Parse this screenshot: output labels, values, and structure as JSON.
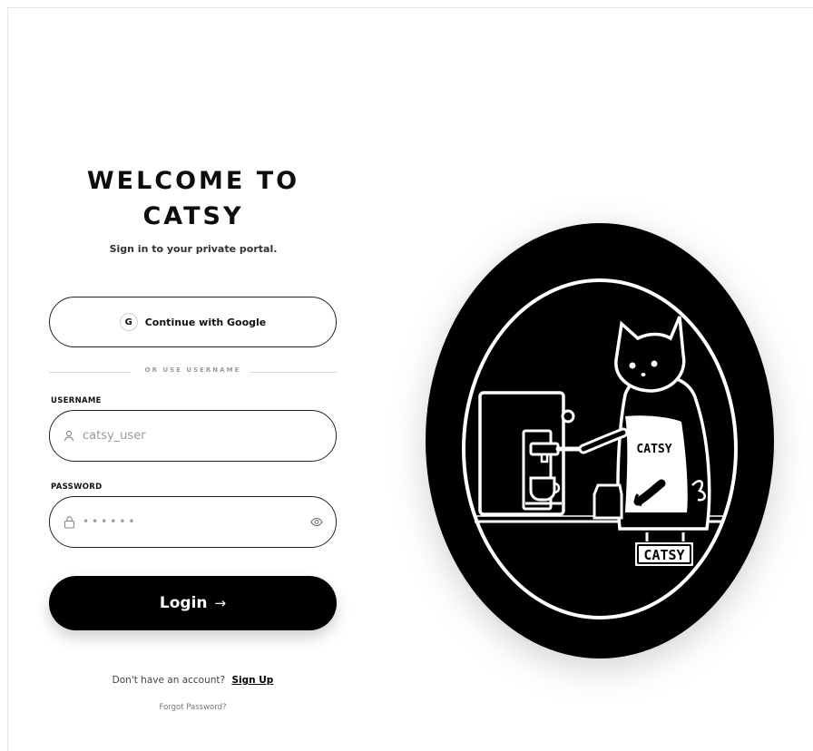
{
  "welcome": {
    "title_line1": "WELCOME TO",
    "title_line2": "CATSY",
    "subtitle": "Sign in to your private portal."
  },
  "google": {
    "badge": "G",
    "label": "Continue with Google"
  },
  "divider": {
    "text": "OR USE USERNAME"
  },
  "username": {
    "label": "USERNAME",
    "placeholder": "catsy_user",
    "value": ""
  },
  "password": {
    "label": "PASSWORD",
    "placeholder": "••••••",
    "value": ""
  },
  "login": {
    "label": "Login",
    "arrow": "→"
  },
  "footer": {
    "no_account": "Don't have an account?",
    "signup": "Sign Up",
    "forgot": "Forgot Password?"
  },
  "logo": {
    "apron_text": "CATSY",
    "sign_text": "CATSY"
  },
  "icons": {
    "google": "google-icon",
    "user": "user-icon",
    "lock": "lock-icon",
    "eye": "eye-icon",
    "arrow": "arrow-right-icon"
  },
  "colors": {
    "primary": "#000000",
    "background": "#ffffff",
    "muted": "#9a9a9a"
  }
}
